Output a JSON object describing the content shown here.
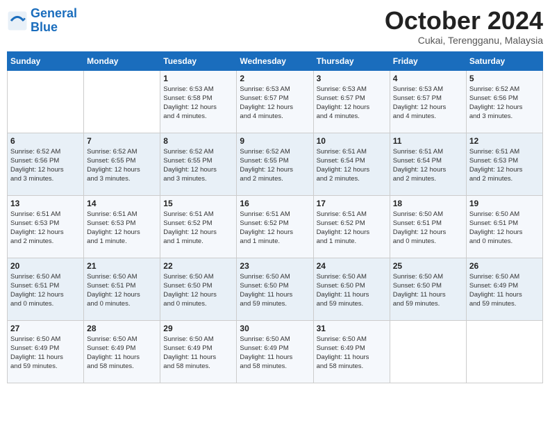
{
  "logo": {
    "line1": "General",
    "line2": "Blue"
  },
  "title": "October 2024",
  "subtitle": "Cukai, Terengganu, Malaysia",
  "headers": [
    "Sunday",
    "Monday",
    "Tuesday",
    "Wednesday",
    "Thursday",
    "Friday",
    "Saturday"
  ],
  "weeks": [
    [
      {
        "num": "",
        "detail": ""
      },
      {
        "num": "",
        "detail": ""
      },
      {
        "num": "1",
        "detail": "Sunrise: 6:53 AM\nSunset: 6:58 PM\nDaylight: 12 hours\nand 4 minutes."
      },
      {
        "num": "2",
        "detail": "Sunrise: 6:53 AM\nSunset: 6:57 PM\nDaylight: 12 hours\nand 4 minutes."
      },
      {
        "num": "3",
        "detail": "Sunrise: 6:53 AM\nSunset: 6:57 PM\nDaylight: 12 hours\nand 4 minutes."
      },
      {
        "num": "4",
        "detail": "Sunrise: 6:53 AM\nSunset: 6:57 PM\nDaylight: 12 hours\nand 4 minutes."
      },
      {
        "num": "5",
        "detail": "Sunrise: 6:52 AM\nSunset: 6:56 PM\nDaylight: 12 hours\nand 3 minutes."
      }
    ],
    [
      {
        "num": "6",
        "detail": "Sunrise: 6:52 AM\nSunset: 6:56 PM\nDaylight: 12 hours\nand 3 minutes."
      },
      {
        "num": "7",
        "detail": "Sunrise: 6:52 AM\nSunset: 6:55 PM\nDaylight: 12 hours\nand 3 minutes."
      },
      {
        "num": "8",
        "detail": "Sunrise: 6:52 AM\nSunset: 6:55 PM\nDaylight: 12 hours\nand 3 minutes."
      },
      {
        "num": "9",
        "detail": "Sunrise: 6:52 AM\nSunset: 6:55 PM\nDaylight: 12 hours\nand 2 minutes."
      },
      {
        "num": "10",
        "detail": "Sunrise: 6:51 AM\nSunset: 6:54 PM\nDaylight: 12 hours\nand 2 minutes."
      },
      {
        "num": "11",
        "detail": "Sunrise: 6:51 AM\nSunset: 6:54 PM\nDaylight: 12 hours\nand 2 minutes."
      },
      {
        "num": "12",
        "detail": "Sunrise: 6:51 AM\nSunset: 6:53 PM\nDaylight: 12 hours\nand 2 minutes."
      }
    ],
    [
      {
        "num": "13",
        "detail": "Sunrise: 6:51 AM\nSunset: 6:53 PM\nDaylight: 12 hours\nand 2 minutes."
      },
      {
        "num": "14",
        "detail": "Sunrise: 6:51 AM\nSunset: 6:53 PM\nDaylight: 12 hours\nand 1 minute."
      },
      {
        "num": "15",
        "detail": "Sunrise: 6:51 AM\nSunset: 6:52 PM\nDaylight: 12 hours\nand 1 minute."
      },
      {
        "num": "16",
        "detail": "Sunrise: 6:51 AM\nSunset: 6:52 PM\nDaylight: 12 hours\nand 1 minute."
      },
      {
        "num": "17",
        "detail": "Sunrise: 6:51 AM\nSunset: 6:52 PM\nDaylight: 12 hours\nand 1 minute."
      },
      {
        "num": "18",
        "detail": "Sunrise: 6:50 AM\nSunset: 6:51 PM\nDaylight: 12 hours\nand 0 minutes."
      },
      {
        "num": "19",
        "detail": "Sunrise: 6:50 AM\nSunset: 6:51 PM\nDaylight: 12 hours\nand 0 minutes."
      }
    ],
    [
      {
        "num": "20",
        "detail": "Sunrise: 6:50 AM\nSunset: 6:51 PM\nDaylight: 12 hours\nand 0 minutes."
      },
      {
        "num": "21",
        "detail": "Sunrise: 6:50 AM\nSunset: 6:51 PM\nDaylight: 12 hours\nand 0 minutes."
      },
      {
        "num": "22",
        "detail": "Sunrise: 6:50 AM\nSunset: 6:50 PM\nDaylight: 12 hours\nand 0 minutes."
      },
      {
        "num": "23",
        "detail": "Sunrise: 6:50 AM\nSunset: 6:50 PM\nDaylight: 11 hours\nand 59 minutes."
      },
      {
        "num": "24",
        "detail": "Sunrise: 6:50 AM\nSunset: 6:50 PM\nDaylight: 11 hours\nand 59 minutes."
      },
      {
        "num": "25",
        "detail": "Sunrise: 6:50 AM\nSunset: 6:50 PM\nDaylight: 11 hours\nand 59 minutes."
      },
      {
        "num": "26",
        "detail": "Sunrise: 6:50 AM\nSunset: 6:49 PM\nDaylight: 11 hours\nand 59 minutes."
      }
    ],
    [
      {
        "num": "27",
        "detail": "Sunrise: 6:50 AM\nSunset: 6:49 PM\nDaylight: 11 hours\nand 59 minutes."
      },
      {
        "num": "28",
        "detail": "Sunrise: 6:50 AM\nSunset: 6:49 PM\nDaylight: 11 hours\nand 58 minutes."
      },
      {
        "num": "29",
        "detail": "Sunrise: 6:50 AM\nSunset: 6:49 PM\nDaylight: 11 hours\nand 58 minutes."
      },
      {
        "num": "30",
        "detail": "Sunrise: 6:50 AM\nSunset: 6:49 PM\nDaylight: 11 hours\nand 58 minutes."
      },
      {
        "num": "31",
        "detail": "Sunrise: 6:50 AM\nSunset: 6:49 PM\nDaylight: 11 hours\nand 58 minutes."
      },
      {
        "num": "",
        "detail": ""
      },
      {
        "num": "",
        "detail": ""
      }
    ]
  ]
}
